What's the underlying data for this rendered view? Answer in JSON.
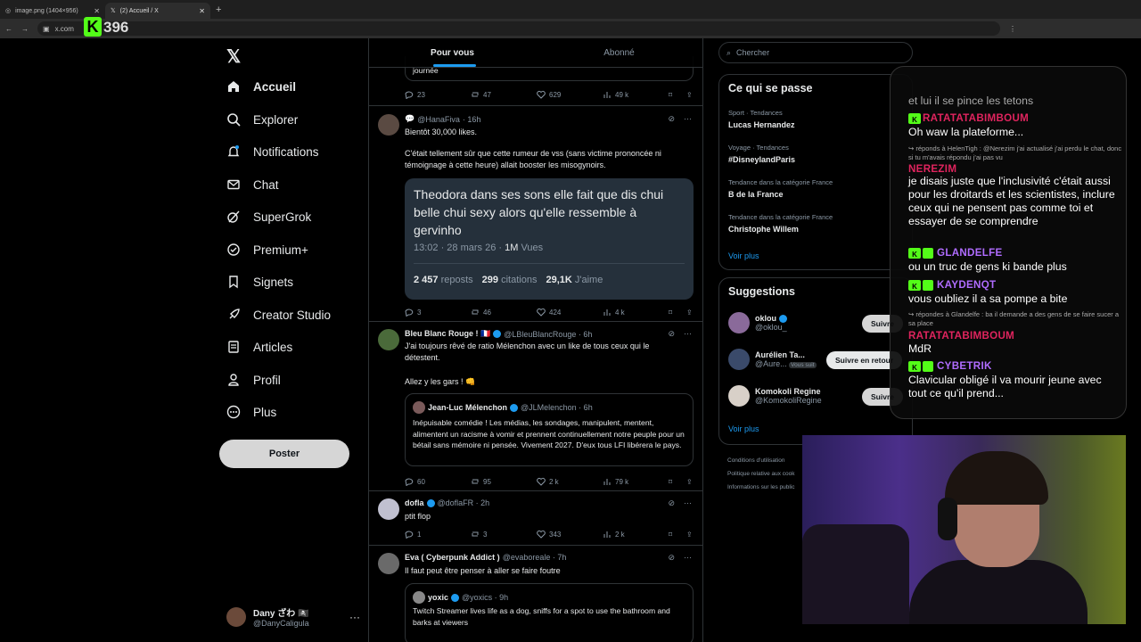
{
  "browser": {
    "tabs": [
      {
        "title": "image.png (1404×956)"
      },
      {
        "title": "(2) Accueil / X"
      }
    ],
    "url": "x.com",
    "overlay_count": "396"
  },
  "nav": {
    "items": [
      {
        "label": "Accueil"
      },
      {
        "label": "Explorer"
      },
      {
        "label": "Notifications"
      },
      {
        "label": "Chat"
      },
      {
        "label": "SuperGrok"
      },
      {
        "label": "Premium+"
      },
      {
        "label": "Signets"
      },
      {
        "label": "Creator Studio"
      },
      {
        "label": "Articles"
      },
      {
        "label": "Profil"
      },
      {
        "label": "Plus"
      }
    ],
    "post_button": "Poster",
    "account": {
      "name": "Dany ざわ 🏴‍☠️",
      "handle": "@DanyCaligula"
    }
  },
  "feed": {
    "tabs": [
      "Pour vous",
      "Abonné"
    ],
    "top_partial": {
      "text": "journée",
      "stats": [
        "23",
        "47",
        "629",
        "49 k"
      ]
    },
    "tweets": [
      {
        "author": "@HanaFiva",
        "time": "· 16h",
        "text1": "Bientôt 30,000 likes.",
        "text2": "C'était tellement sûr que cette rumeur de vss (sans victime prononcée ni témoignage à cette heure) allait booster les misogynoirs.",
        "quote_text": "Theodora dans ses sons elle fait que dis chui belle chui sexy alors qu'elle ressemble à gervinho",
        "quote_time": "13:02 · 28 mars 26 ·",
        "quote_views_n": "1M",
        "quote_views_l": "Vues",
        "quote_reposts_n": "2 457",
        "quote_reposts_l": "reposts",
        "quote_citations_n": "299",
        "quote_citations_l": "citations",
        "quote_likes_n": "29,1K",
        "quote_likes_l": "J'aime",
        "stats": [
          "3",
          "46",
          "424",
          "4 k"
        ]
      },
      {
        "author": "Bleu Blanc Rouge ! 🇫🇷",
        "handle": "@LBleuBlancRouge · 6h",
        "text1": "J'ai toujours rêvé de ratio Mélenchon avec un like de tous ceux qui le détestent.",
        "text2": "Allez y les gars ! 👊",
        "quote_author": "Jean-Luc Mélenchon",
        "quote_handle": "@JLMelenchon · 6h",
        "quote_text": "Inépuisable comédie ! Les médias, les sondages, manipulent, mentent, alimentent un racisme à vomir et prennent continuellement notre peuple pour un bétail sans mémoire ni pensée. Vivement 2027. D'eux tous LFI libérera le pays.",
        "stats": [
          "60",
          "95",
          "2 k",
          "79 k"
        ]
      },
      {
        "author": "dofla",
        "handle": "@doflaFR · 2h",
        "text1": "ptit flop",
        "stats": [
          "1",
          "3",
          "343",
          "2 k"
        ]
      },
      {
        "author": "Eva ( Cyberpunk Addict )",
        "handle": "@evaboreale · 7h",
        "text1": "Il faut peut être penser à aller se faire foutre",
        "quote_author": "yoxic",
        "quote_handle": "@yoxics · 9h",
        "quote_text": "Twitch Streamer lives life as a dog, sniffs for a spot to use the bathroom and barks at viewers"
      }
    ]
  },
  "sidebar_right": {
    "search_placeholder": "Chercher",
    "trends_title": "Ce qui se passe",
    "trends": [
      {
        "context": "Sport · Tendances",
        "name": "Lucas Hernandez"
      },
      {
        "context": "Voyage · Tendances",
        "name": "#DisneylandParis"
      },
      {
        "context": "Tendance dans la catégorie France",
        "name": "B de la France"
      },
      {
        "context": "Tendance dans la catégorie France",
        "name": "Christophe Willem"
      }
    ],
    "see_more": "Voir plus",
    "suggestions_title": "Suggestions",
    "suggestions": [
      {
        "name": "oklou",
        "handle": "@oklou_",
        "button": "Suivre"
      },
      {
        "name": "Aurélien Ta...",
        "handle": "@Aure...",
        "badge": "Vous suit",
        "button": "Suivre en retour"
      },
      {
        "name": "Komokoli Regine",
        "handle": "@KomokoliRegine",
        "button": "Suivre"
      }
    ],
    "footer": [
      "Conditions d'utilisation",
      "Politique relative aux cook",
      "Informations sur les public"
    ]
  },
  "chat_overlay": {
    "lines": [
      {
        "type": "msg",
        "text": "et lui il se pince les tetons"
      },
      {
        "type": "user",
        "name": "RATATATABIMBOUM",
        "color": "#e0245e"
      },
      {
        "type": "msg",
        "text": "Oh waw la plateforme..."
      },
      {
        "type": "reply",
        "text": "↪ réponds à HelenTigh : @Nerezim j'ai actualisé j'ai perdu le chat, donc si tu m'avais répondu j'ai pas vu"
      },
      {
        "type": "user",
        "name": "NEREZIM",
        "color": "#e0245e"
      },
      {
        "type": "msg",
        "text": "je disais juste que l'inclusivité c'était aussi pour les droitards et les scientistes, inclure ceux qui ne pensent pas comme toi et essayer de se comprendre"
      },
      {
        "type": "user",
        "name": "GLANDELFE",
        "color": "#b06cff"
      },
      {
        "type": "msg",
        "text": "ou un truc de gens ki bande plus"
      },
      {
        "type": "user",
        "name": "KAYDENQT",
        "color": "#b06cff"
      },
      {
        "type": "msg",
        "text": "vous oubliez il a sa pompe a bite"
      },
      {
        "type": "reply",
        "text": "↪ répondes à Glandelfe : ba il demande a des gens de se faire sucer a sa place"
      },
      {
        "type": "user",
        "name": "RATATATABIMBOUM",
        "color": "#e0245e"
      },
      {
        "type": "msg",
        "text": "MdR"
      },
      {
        "type": "user",
        "name": "CYBETRIK",
        "color": "#b06cff"
      },
      {
        "type": "msg",
        "text": "Clavicular obligé il va mourir jeune avec tout ce qu'il prend..."
      }
    ]
  }
}
